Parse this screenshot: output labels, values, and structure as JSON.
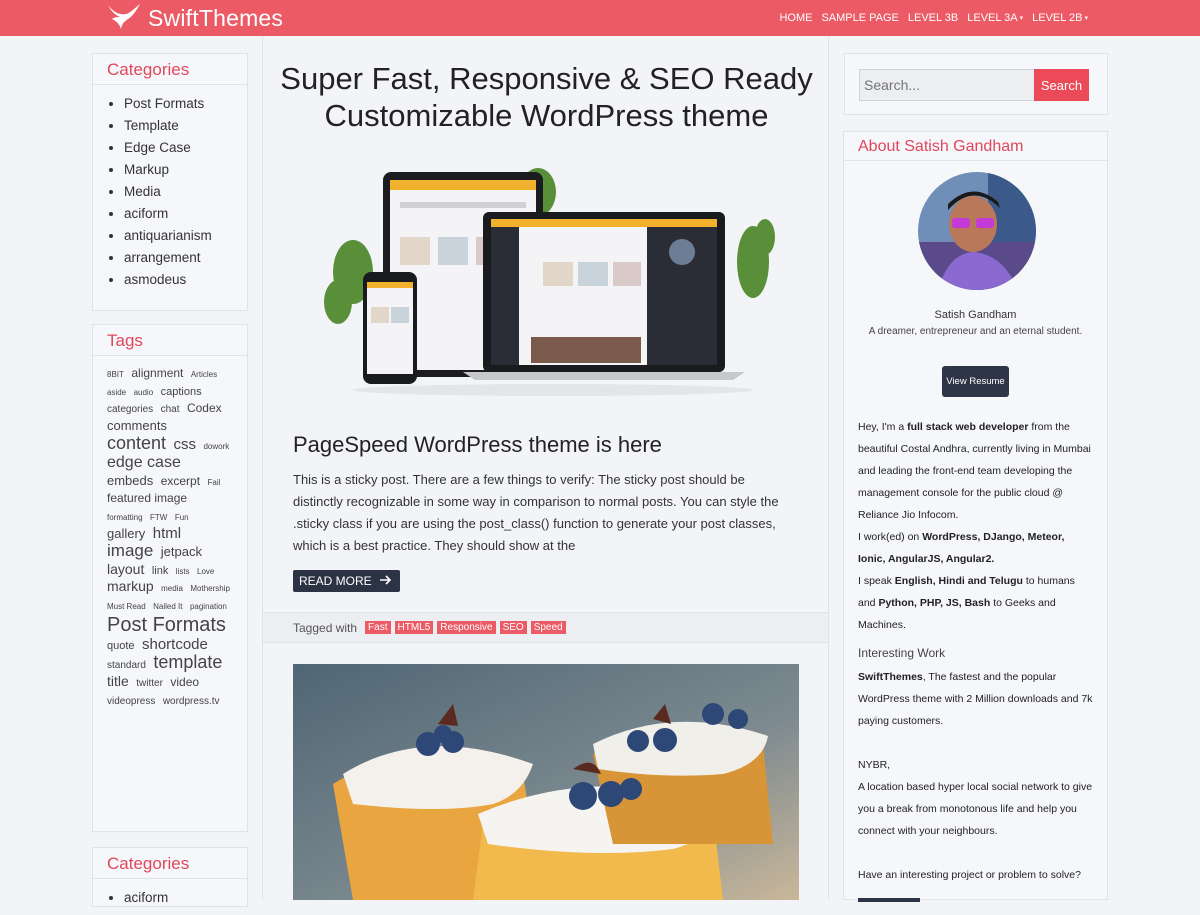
{
  "header": {
    "brand": "SwiftThemes",
    "nav": [
      {
        "label": "HOME",
        "dropdown": false
      },
      {
        "label": "SAMPLE PAGE",
        "dropdown": false
      },
      {
        "label": "LEVEL 3B",
        "dropdown": false
      },
      {
        "label": "LEVEL 3A",
        "dropdown": true
      },
      {
        "label": "LEVEL 2B",
        "dropdown": true
      }
    ]
  },
  "left_sidebar": {
    "categories_title": "Categories",
    "categories": [
      "Post Formats",
      "Template",
      "Edge Case",
      "Markup",
      "Media",
      "aciform",
      "antiquarianism",
      "arrangement",
      "asmodeus"
    ],
    "tags_title": "Tags",
    "tags": [
      {
        "label": "8BIT",
        "size": 8
      },
      {
        "label": "alignment",
        "size": 12
      },
      {
        "label": "Articles",
        "size": 8
      },
      {
        "label": "aside",
        "size": 8
      },
      {
        "label": "audio",
        "size": 8
      },
      {
        "label": "captions",
        "size": 11
      },
      {
        "label": "categories",
        "size": 10
      },
      {
        "label": "chat",
        "size": 10
      },
      {
        "label": "Codex",
        "size": 12
      },
      {
        "label": "comments",
        "size": 13
      },
      {
        "label": "content",
        "size": 18
      },
      {
        "label": "css",
        "size": 15
      },
      {
        "label": "dowork",
        "size": 8
      },
      {
        "label": "edge case",
        "size": 16
      },
      {
        "label": "embeds",
        "size": 13
      },
      {
        "label": "excerpt",
        "size": 12
      },
      {
        "label": "Fail",
        "size": 8
      },
      {
        "label": "featured image",
        "size": 12
      },
      {
        "label": "formatting",
        "size": 8
      },
      {
        "label": "FTW",
        "size": 8
      },
      {
        "label": "Fun",
        "size": 8
      },
      {
        "label": "gallery",
        "size": 13
      },
      {
        "label": "html",
        "size": 15
      },
      {
        "label": "image",
        "size": 17
      },
      {
        "label": "jetpack",
        "size": 13
      },
      {
        "label": "layout",
        "size": 14
      },
      {
        "label": "link",
        "size": 11
      },
      {
        "label": "lists",
        "size": 8
      },
      {
        "label": "Love",
        "size": 8
      },
      {
        "label": "markup",
        "size": 14
      },
      {
        "label": "media",
        "size": 8
      },
      {
        "label": "Mothership",
        "size": 8
      },
      {
        "label": "Must Read",
        "size": 8
      },
      {
        "label": "Nailed It",
        "size": 8
      },
      {
        "label": "pagination",
        "size": 8
      },
      {
        "label": "Post Formats",
        "size": 20
      },
      {
        "label": "quote",
        "size": 11
      },
      {
        "label": "shortcode",
        "size": 15
      },
      {
        "label": "standard",
        "size": 10
      },
      {
        "label": "template",
        "size": 18
      },
      {
        "label": "title",
        "size": 14
      },
      {
        "label": "twitter",
        "size": 10
      },
      {
        "label": "video",
        "size": 12
      },
      {
        "label": "videopress",
        "size": 10
      },
      {
        "label": "wordpress.tv",
        "size": 10
      }
    ],
    "categories2_title": "Categories",
    "categories2": [
      "aciform"
    ]
  },
  "main": {
    "hero_title_line1": "Super Fast, Responsive & SEO Ready",
    "hero_title_line2": "Customizable WordPress theme",
    "post_title": "PageSpeed WordPress theme is here",
    "excerpt": "This is a sticky post. There are a few things to verify: The sticky post should be distinctly recognizable in some way in comparison to normal posts. You can style the .sticky class if you are using the post_class() function to generate your post classes, which is a best practice. They should show at the",
    "read_more": "READ MORE",
    "tagged_with": "Tagged with",
    "post_tags": [
      "Fast",
      "HTML5",
      "Responsive",
      "SEO",
      "Speed"
    ]
  },
  "right_sidebar": {
    "search_placeholder": "Search...",
    "search_button": "Search",
    "about_title": "About Satish Gandham",
    "name": "Satish Gandham",
    "tagline": "A dreamer, entrepreneur and an eternal student.",
    "resume_button": "View Resume",
    "bio1_pre": "Hey, I'm a ",
    "bio1_bold": "full stack web developer",
    "bio1_post": " from the beautiful Costal Andhra, currently living in Mumbai and leading the front-end team developing the management console for the public cloud @ Reliance Jio Infocom.",
    "bio2_pre": "I work(ed) on ",
    "bio2_bold": "WordPress, DJango, Meteor, Ionic, AngularJS, Angular2.",
    "bio3_pre": "I speak ",
    "bio3_bold1": "English, Hindi and Telugu",
    "bio3_mid": " to humans and ",
    "bio3_bold2": "Python, PHP, JS, Bash",
    "bio3_post": " to Geeks and Machines.",
    "interesting_heading": "Interesting Work",
    "work1_bold": "SwiftThemes",
    "work1_text": ", The fastest and the popular WordPress theme with 2 Million downloads and 7k paying customers.",
    "work2_title": "NYBR,",
    "work2_text": "A location based hyper local social network to give you a break from monotonous life and help you connect with your neighbours.",
    "cta": "Have an interesting project or problem to solve?"
  },
  "colors": {
    "accent": "#ec5a66",
    "dark_button": "#2c3345",
    "background": "#f3f4f8"
  }
}
